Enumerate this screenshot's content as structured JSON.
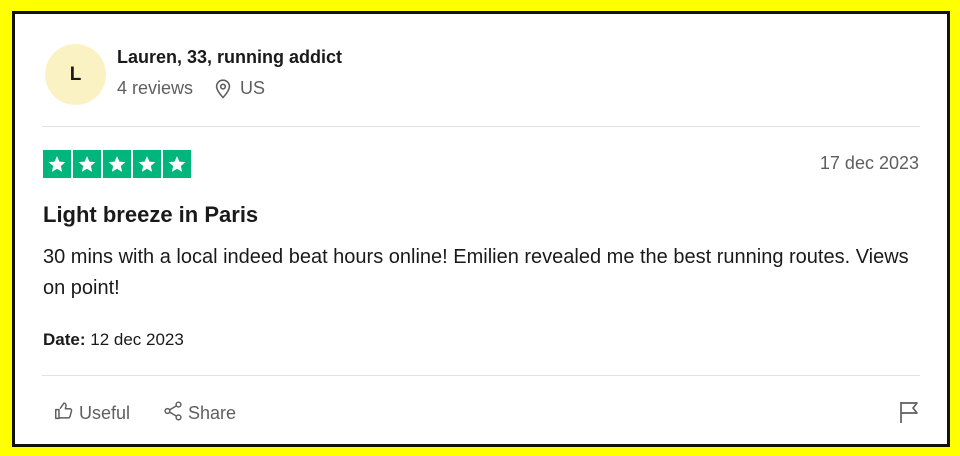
{
  "reviewer": {
    "initial": "L",
    "name": "Lauren, 33, running addict",
    "reviews_count": "4 reviews",
    "location": "US"
  },
  "review": {
    "rating": 5,
    "max_rating": 5,
    "star_color": "#00b67a",
    "posted_date": "17 dec 2023",
    "title": "Light breeze in Paris",
    "body": "30 mins with a local indeed beat hours online! Emilien revealed me the best running routes. Views on point!",
    "experience_label": "Date:",
    "experience_date": "12 dec 2023"
  },
  "actions": {
    "useful_label": "Useful",
    "share_label": "Share",
    "icons": [
      "thumbs-up-icon",
      "share-icon",
      "flag-icon",
      "location-pin-icon",
      "star-icon"
    ]
  },
  "colors": {
    "background": "#ffff00",
    "avatar_bg": "#fbf2c4",
    "muted_text": "#5f5f5f"
  }
}
